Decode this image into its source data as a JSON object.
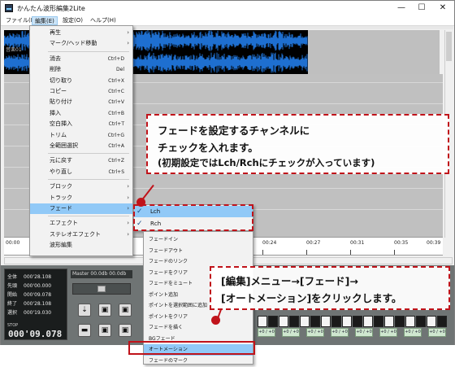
{
  "window": {
    "title": "かんたん波形編集2Lite",
    "controls": {
      "minimize": "—",
      "maximize": "☐",
      "close": "✕"
    }
  },
  "menubar": [
    "ファイル(F)",
    "編集(E)",
    "設定(O)",
    "ヘルプ(H)"
  ],
  "wave_label": "音楽01",
  "ruler_ticks": [
    "00:00",
    "00:24",
    "00:27",
    "00:31",
    "00:35",
    "00:39"
  ],
  "bottom_panel": {
    "counter_rows": [
      {
        "label": "全体",
        "value": "000'28.108"
      },
      {
        "label": "先頭",
        "value": "000'00.000"
      },
      {
        "label": "開始",
        "value": "000'09.078"
      },
      {
        "label": "終了",
        "value": "000'28.108"
      },
      {
        "label": "選択",
        "value": "000'19.030"
      }
    ],
    "stop_label": "STOP",
    "big_time": "000'09.078",
    "master": "Master  00.0db  00.0db",
    "track_cell_label": "+0 / +0"
  },
  "edit_menu": [
    {
      "label": "再生",
      "shortcut": "",
      "submenu": true
    },
    {
      "label": "マーク/ヘッド移動",
      "shortcut": "",
      "submenu": true
    },
    {
      "sep": true
    },
    {
      "label": "消去",
      "shortcut": "Ctrl+D"
    },
    {
      "label": "削除",
      "shortcut": "Del"
    },
    {
      "label": "切り取り",
      "shortcut": "Ctrl+X"
    },
    {
      "label": "コピー",
      "shortcut": "Ctrl+C"
    },
    {
      "label": "貼り付け",
      "shortcut": "Ctrl+V"
    },
    {
      "label": "挿入",
      "shortcut": "Ctrl+B"
    },
    {
      "label": "空白挿入",
      "shortcut": "Ctrl+T"
    },
    {
      "label": "トリム",
      "shortcut": "Ctrl+G"
    },
    {
      "label": "全範囲選択",
      "shortcut": "Ctrl+A"
    },
    {
      "sep": true
    },
    {
      "label": "元に戻す",
      "shortcut": "Ctrl+Z"
    },
    {
      "label": "やり直し",
      "shortcut": "Ctrl+S"
    },
    {
      "sep": true
    },
    {
      "label": "ブロック",
      "shortcut": "",
      "submenu": true
    },
    {
      "label": "トラック",
      "shortcut": "",
      "submenu": true
    },
    {
      "label": "フェード",
      "shortcut": "",
      "submenu": true,
      "highlight": true
    },
    {
      "sep": true
    },
    {
      "label": "エフェクト",
      "shortcut": "",
      "submenu": true
    },
    {
      "label": "ステレオエフェクト",
      "shortcut": "",
      "submenu": true
    },
    {
      "label": "波形編集",
      "shortcut": ""
    }
  ],
  "channel_submenu": [
    {
      "label": "Lch",
      "checked": true
    },
    {
      "label": "Rch",
      "checked": true
    }
  ],
  "fade_submenu": [
    "フェードイン",
    "フェードアウト",
    "フェードのリンク",
    "フェードをクリア",
    "フェードをミュート",
    "ポイント追加",
    "ポイントを選択範囲に追加",
    "ポイントをクリア",
    "フェードを描く",
    "BGフェード",
    "オートメーション",
    "フェードのマーク"
  ],
  "fade_highlight_index": 10,
  "annotations": {
    "callout1": [
      "フェードを設定するチャンネルに",
      "チェックを入れます。",
      "(初期設定ではLch/Rchにチェックが入っています)"
    ],
    "callout2": [
      "[編集]メニュー→[フェード]→",
      "[オートメーション]をクリックします。"
    ]
  },
  "colors": {
    "accent_red": "#c0131a",
    "menu_highlight": "#91c9f7",
    "waveform": "#1e6fd0"
  }
}
